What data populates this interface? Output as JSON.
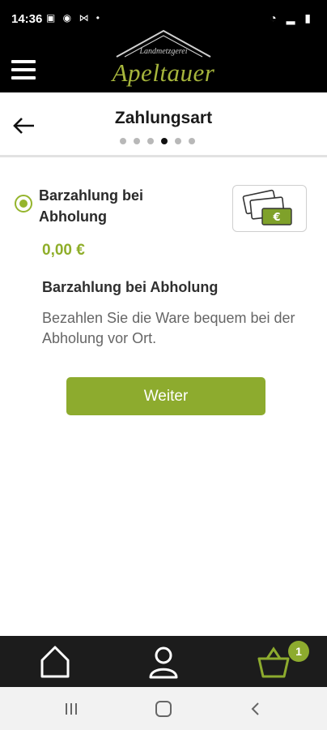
{
  "status_bar": {
    "time": "14:36",
    "left_icons": "▣ ◉ ⋈ •",
    "right_icons": "◔ ▂ ▮"
  },
  "header": {
    "logo_subtitle": "Landmetzgerei",
    "logo_name": "Apeltauer",
    "menu_icon": "hamburger-icon"
  },
  "page": {
    "title": "Zahlungsart",
    "back_icon": "arrow-left-icon",
    "steps": {
      "total": 6,
      "current": 4
    }
  },
  "payment_option": {
    "label": "Barzahlung bei Abholung",
    "selected": true,
    "icon": "cash-euro-icon",
    "price": "0,00 €",
    "method_title": "Barzahlung bei Abholung",
    "description": "Bezahlen Sie die Ware bequem bei der Abholung vor Ort."
  },
  "actions": {
    "continue_label": "Weiter"
  },
  "bottom_nav": {
    "items": [
      {
        "name": "home",
        "icon": "home-icon"
      },
      {
        "name": "account",
        "icon": "user-icon"
      },
      {
        "name": "cart",
        "icon": "basket-icon"
      }
    ],
    "cart_count": "1"
  },
  "colors": {
    "accent": "#8dab2e",
    "header_bg": "#000000",
    "nav_bg": "#1c1c1c"
  }
}
